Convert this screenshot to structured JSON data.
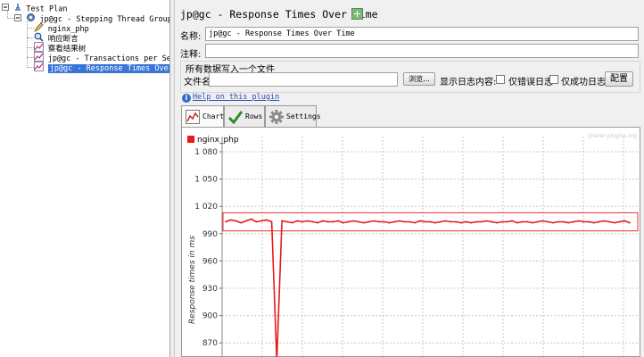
{
  "tree": {
    "items": [
      {
        "label": "Test Plan",
        "icon": "test-plan-icon"
      },
      {
        "label": "jp@gc - Stepping Thread Group (deprec",
        "icon": "thread-group-gear-icon"
      },
      {
        "label": "nginx_php",
        "icon": "http-sampler-pen-icon"
      },
      {
        "label": "响应断言",
        "icon": "assertion-magnifier-icon"
      },
      {
        "label": "察看结果树",
        "icon": "listener-chart-icon"
      },
      {
        "label": "jp@gc - Transactions per Second",
        "icon": "listener-chart-icon"
      },
      {
        "label": "jp@gc - Response Times Over Time",
        "icon": "listener-chart-icon"
      }
    ]
  },
  "panel": {
    "title": "jp@gc - Response Times Over Time",
    "name_label": "名称:",
    "name_value": "jp@gc - Response Times Over Time",
    "comment_label": "注释:",
    "comment_value": "",
    "file_group_title": "所有数据写入一个文件",
    "file_label": "文件名",
    "file_value": "",
    "browse_button": "浏览...",
    "log_label": "显示日志内容:",
    "errors_only_label": "仅错误日志",
    "success_only_label": "仅成功日志",
    "configure_button": "配置",
    "help_link": "Help on this plugin"
  },
  "tabs": [
    {
      "label": "Chart",
      "icon": "chart-icon",
      "active": true
    },
    {
      "label": "Rows",
      "icon": "checkmark-icon",
      "active": false
    },
    {
      "label": "Settings",
      "icon": "gear-icon",
      "active": false
    }
  ],
  "colors": {
    "series": "#e8191a",
    "selection": "#3875d7",
    "link": "#2a4fb3"
  },
  "chart_data": {
    "type": "line",
    "title": "",
    "watermark": "jmeter-plugins.org",
    "legend": {
      "position": "top-left"
    },
    "xlabel": "",
    "ylabel": "Response times in ms",
    "ylim": [
      850,
      1080
    ],
    "yticks": [
      1080,
      1050,
      1020,
      990,
      960,
      930,
      900,
      870
    ],
    "ytick_labels": [
      "1 080",
      "1 050",
      "1 020",
      "990",
      "960",
      "930",
      "900",
      "870"
    ],
    "grid": true,
    "series": [
      {
        "name": "nginx_php",
        "color": "#e8191a",
        "values": [
          1003,
          1005,
          1004,
          1002,
          1004,
          1006,
          1003,
          1004,
          1005,
          1003,
          850,
          1004,
          1003,
          1002,
          1004,
          1003,
          1004,
          1003,
          1002,
          1004,
          1003,
          1003,
          1004,
          1002,
          1003,
          1004,
          1003,
          1002,
          1003,
          1004,
          1003,
          1003,
          1002,
          1003,
          1004,
          1003,
          1003,
          1002,
          1004,
          1003,
          1003,
          1002,
          1003,
          1004,
          1003,
          1003,
          1002,
          1003,
          1002,
          1003,
          1003,
          1004,
          1003,
          1002,
          1003,
          1003,
          1004,
          1002,
          1003,
          1003,
          1002,
          1003,
          1004,
          1003,
          1002,
          1003,
          1003,
          1002,
          1003,
          1004,
          1003,
          1003,
          1002,
          1003,
          1004,
          1003,
          1002,
          1003,
          1004,
          1002
        ]
      }
    ]
  }
}
